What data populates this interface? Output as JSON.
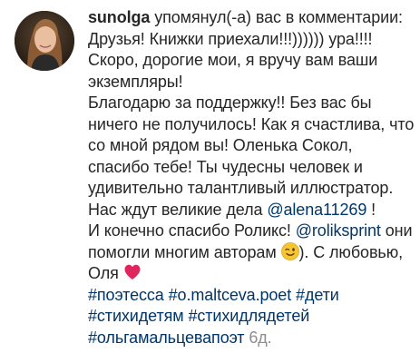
{
  "notification": {
    "username": "sunolga",
    "action_text": " упомянул(-а) вас в комментарии: Друзья! Книжки приехали!!!)))))) ура!!!!",
    "paragraph_2": "Скоро, дорогие мои, я вручу вам ваши экземпляры!",
    "paragraph_3_before": "Благодарю за поддержку!! Без вас бы ничего не получилось! Как я счастлива, что со мной рядом вы! Оленька Сокол, спасибо тебе! Ты чудесны человек и удивительно талантливый иллюстратор. Нас ждут великие дела ",
    "mention_1": "@alena11269",
    "paragraph_3_after": " !",
    "paragraph_4_before": "И конечно спасибо Роликс! ",
    "mention_2": "@roliksprint",
    "paragraph_4_mid": " они помогли многим авторам ",
    "paragraph_4_after_wink": "). С любовью, Оля ",
    "hashtags": [
      "#поэтесса",
      "#o.maltceva.poet",
      "#дети",
      "#стихидетям",
      "#стихидлядетей",
      "#ольгамальцевапоэт"
    ],
    "timestamp": "6д.",
    "emoji_wink": "winking-face-emoji",
    "emoji_heart": "red-heart-emoji",
    "colors": {
      "text": "#262626",
      "link": "#00376b",
      "timestamp": "#8e8e8e",
      "heart": "#e0245e"
    }
  }
}
